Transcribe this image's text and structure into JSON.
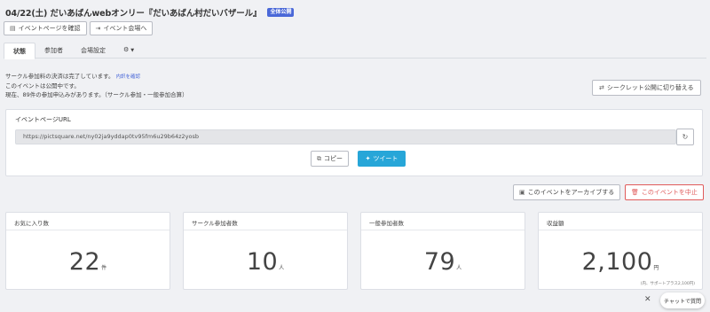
{
  "header": {
    "title": "04/22(土) だいあばんwebオンリー『だいあばん村だいバザール』",
    "badge": "全体公開"
  },
  "top_buttons": {
    "event_page": "イベントページを確認",
    "event_venue": "イベント会場へ"
  },
  "tabs": [
    {
      "label": "状態",
      "active": true
    },
    {
      "label": "参加者",
      "active": false
    },
    {
      "label": "会場設定",
      "active": false
    },
    {
      "label": "⚙",
      "active": false
    }
  ],
  "info": {
    "line1": "サークル参加料の決済は完了しています。",
    "line1_link": "内訳を確認",
    "line2": "このイベントは公開中です。",
    "line3": "現在、89件の参加申込みがあります。（サークル参加・一般参加合算）"
  },
  "secret_button": "シークレット公開に切り替える",
  "event_url": {
    "label": "イベントページURL",
    "value": "https://pictsquare.net/ny02ja9yddap0tv95fm6u29b64z2yosb",
    "copy": "コピー",
    "tweet": "ツイート"
  },
  "actions": {
    "archive": "このイベントをアーカイブする",
    "cancel": "このイベントを中止"
  },
  "stats": [
    {
      "label": "お気に入り数",
      "value": "22",
      "unit": "件"
    },
    {
      "label": "サークル参加者数",
      "value": "10",
      "unit": "人"
    },
    {
      "label": "一般参加者数",
      "value": "79",
      "unit": "人"
    },
    {
      "label": "収益額",
      "value": "2,100",
      "unit": "円",
      "note": "(内、サポートプラス2,100円)"
    }
  ],
  "chat": {
    "close": "✕",
    "label": "チャットで質問"
  },
  "colors": {
    "accent": "#4a68d8",
    "tweet": "#27a6d8",
    "danger": "#e05b5b",
    "background": "#f0f1f4"
  }
}
